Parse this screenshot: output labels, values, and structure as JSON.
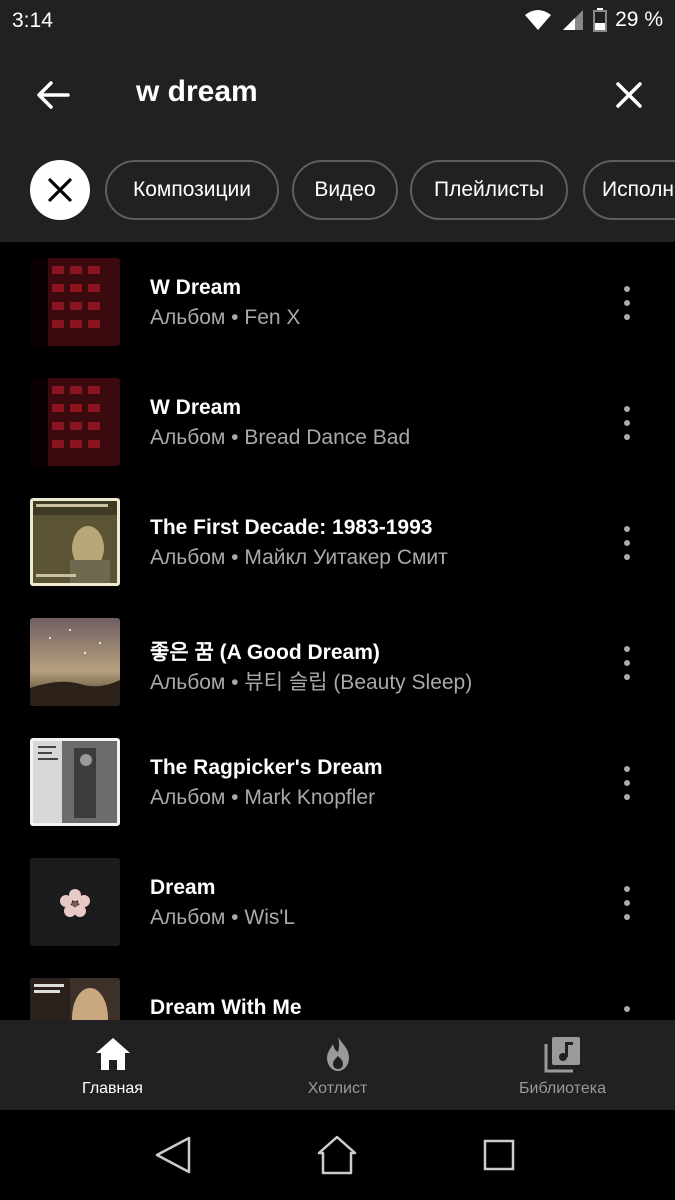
{
  "status_bar": {
    "time": "3:14",
    "battery": "29 %"
  },
  "search": {
    "query": "w dream"
  },
  "filters": {
    "chips": [
      "Композиции",
      "Видео",
      "Плейлисты",
      "Исполн"
    ]
  },
  "results": [
    {
      "title": "W Dream",
      "subtitle": "Альбом • Fen X"
    },
    {
      "title": "W Dream",
      "subtitle": "Альбом • Bread Dance Bad"
    },
    {
      "title": "The First Decade: 1983-1993",
      "subtitle": "Альбом • Майкл Уитакер Смит"
    },
    {
      "title": "좋은 꿈 (A Good Dream)",
      "subtitle": "Альбом • 뷰티 슬립 (Beauty Sleep)"
    },
    {
      "title": "The Ragpicker's Dream",
      "subtitle": "Альбом • Mark Knopfler"
    },
    {
      "title": "Dream",
      "subtitle": "Альбом • Wis'L"
    },
    {
      "title": "Dream With Me",
      "subtitle": ""
    }
  ],
  "bottom_nav": {
    "home": "Главная",
    "hotlist": "Хотлист",
    "library": "Библиотека"
  }
}
